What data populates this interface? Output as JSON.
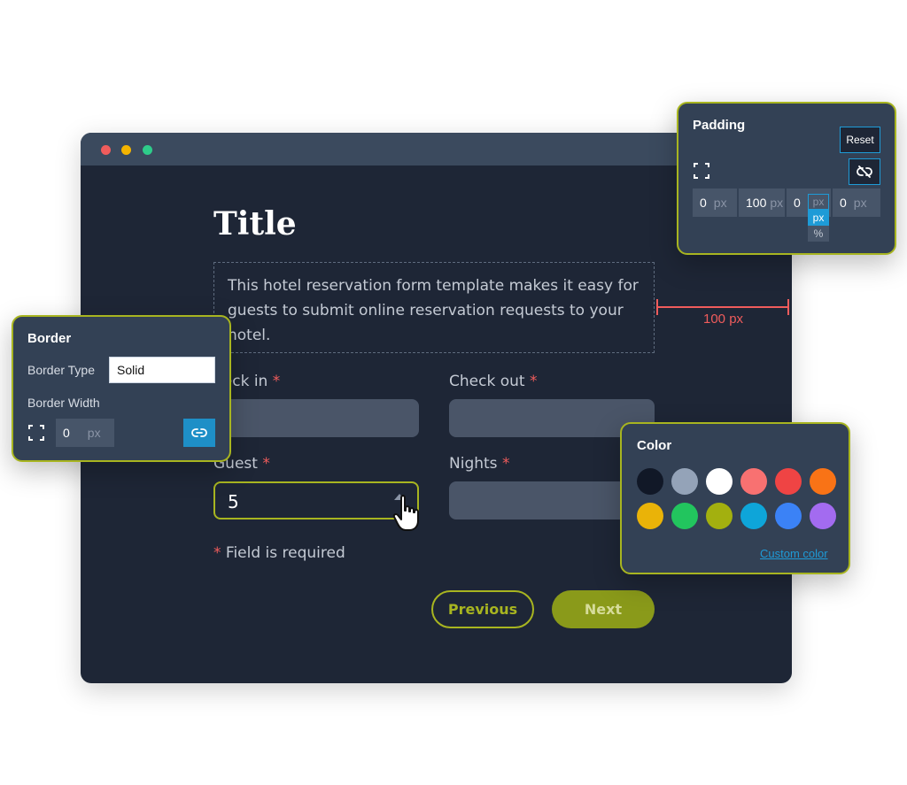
{
  "window": {
    "form_title": "Title",
    "description": "This hotel reservation form template makes it easy for guests to submit online reservation requests to your hotel.",
    "fields": {
      "checkin_label": "heck in",
      "checkout_label": "Check out",
      "guest_label": "Guest",
      "nights_label": "Nights",
      "required_star": "*",
      "guest_value": "5"
    },
    "required_note": "Field is required",
    "buttons": {
      "previous": "Previous",
      "next": "Next"
    }
  },
  "dimension_label": "100 px",
  "padding_panel": {
    "title": "Padding",
    "reset": "Reset",
    "fields": [
      {
        "value": "0",
        "unit": "px"
      },
      {
        "value": "100",
        "unit": "px"
      },
      {
        "value": "0",
        "unit": "px"
      },
      {
        "value": "0",
        "unit": "px"
      }
    ],
    "unit_options": [
      "px",
      "%"
    ]
  },
  "border_panel": {
    "title": "Border",
    "type_label": "Border Type",
    "type_value": "Solid",
    "width_label": "Border Width",
    "width_value": "0",
    "width_unit": "px"
  },
  "color_panel": {
    "title": "Color",
    "swatches": [
      "#111827",
      "#94a3b8",
      "#ffffff",
      "#f87171",
      "#ef4444",
      "#f97316",
      "#eab308",
      "#22c55e",
      "#a3b00f",
      "#0ea5d9",
      "#3b82f6",
      "#a36bf0"
    ],
    "custom_link": "Custom color"
  },
  "colors": {
    "accent": "#a8b520",
    "required": "#f05c5c",
    "link": "#1e9bd7"
  }
}
